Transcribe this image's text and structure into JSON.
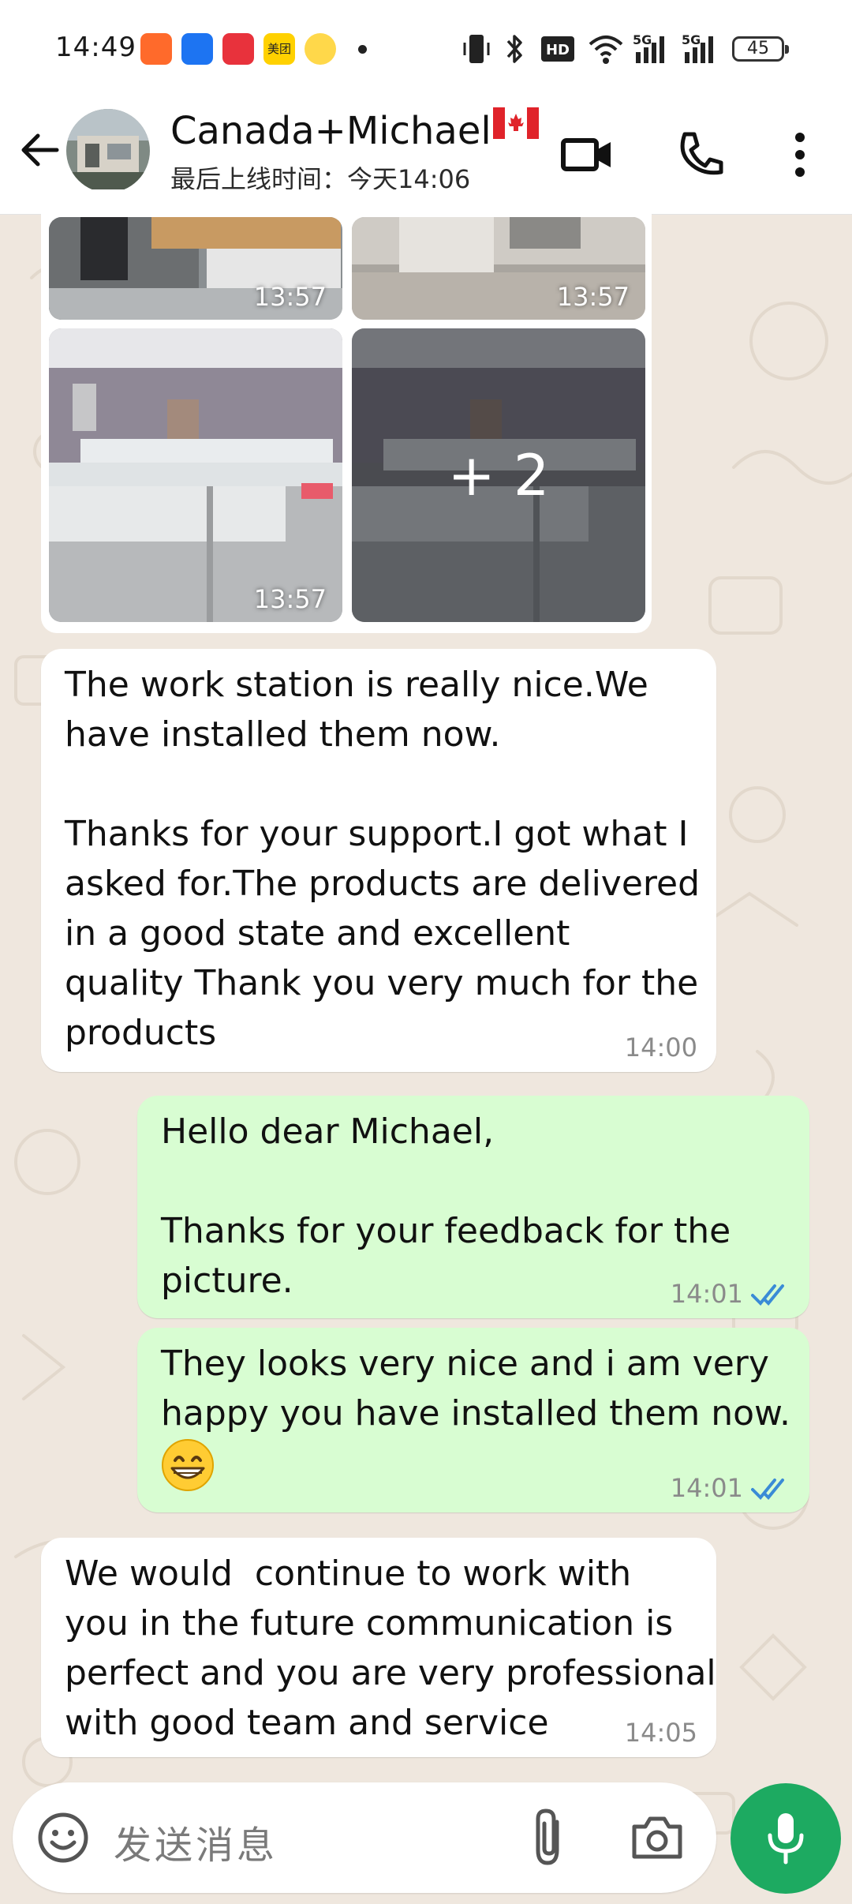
{
  "status_bar": {
    "time": "14:49",
    "battery": "45",
    "signal_1": "5G",
    "signal_2": "5G",
    "hd_badge": "HD2",
    "app_icons": [
      "taobao-icon",
      "alibaba-icon",
      "pinduoduo-icon",
      "meituan-icon",
      "weibo-icon"
    ],
    "meituan_label": "美团"
  },
  "header": {
    "contact_name": "Canada+Michael",
    "last_seen": "最后上线时间：今天14:06"
  },
  "media_grid": {
    "thumbs": [
      {
        "time": "13:57"
      },
      {
        "time": "13:57"
      },
      {
        "time": "13:57"
      },
      {
        "more": "+ 2"
      }
    ]
  },
  "messages": [
    {
      "direction": "incoming",
      "text": "The work station is really nice.We\nhave installed them now.\n\nThanks for your support.I got what I\nasked for.The products are delivered\nin a good state and excellent\nquality Thank you very much for the\nproducts",
      "time": "14:00"
    },
    {
      "direction": "outgoing",
      "text": "Hello dear Michael,\n\nThanks for your feedback for the\npicture.",
      "time": "14:01"
    },
    {
      "direction": "outgoing",
      "text": "They looks very nice and i am very\nhappy you have installed them now.",
      "time": "14:01",
      "emoji": "grinning-face-icon"
    },
    {
      "direction": "incoming",
      "text": "We would  continue to work with\nyou in the future communication is\nperfect and you are very professional\nwith good team and service",
      "time": "14:05"
    }
  ],
  "composer": {
    "placeholder": "发送消息"
  },
  "colors": {
    "accent_green": "#1daa61",
    "outgoing_bubble": "#d8fdd2",
    "read_tick_blue": "#3a8bd6",
    "wallpaper": "#efe7de"
  }
}
